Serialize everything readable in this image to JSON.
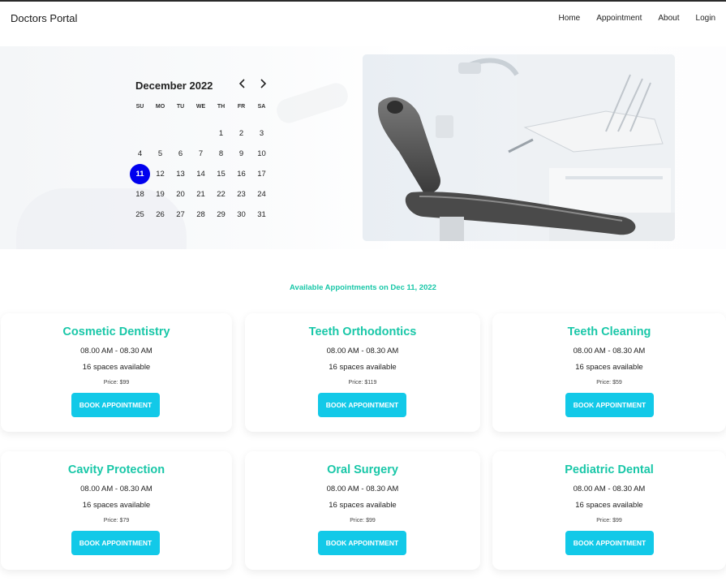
{
  "navbar": {
    "brand": "Doctors Portal",
    "links": [
      "Home",
      "Appointment",
      "About",
      "Login"
    ]
  },
  "calendar": {
    "month_label": "December 2022",
    "weekdays": [
      "SU",
      "MO",
      "TU",
      "WE",
      "TH",
      "FR",
      "SA"
    ],
    "weeks": [
      [
        "",
        "",
        "",
        "",
        "1",
        "2",
        "3"
      ],
      [
        "4",
        "5",
        "6",
        "7",
        "8",
        "9",
        "10"
      ],
      [
        "11",
        "12",
        "13",
        "14",
        "15",
        "16",
        "17"
      ],
      [
        "18",
        "19",
        "20",
        "21",
        "22",
        "23",
        "24"
      ],
      [
        "25",
        "26",
        "27",
        "28",
        "29",
        "30",
        "31"
      ]
    ],
    "selected_day": "11",
    "prev_icon": "chevron-left-icon",
    "next_icon": "chevron-right-icon"
  },
  "hero": {
    "image": "dental-chair-photo"
  },
  "appointments": {
    "title": "Available Appointments on Dec 11, 2022",
    "services": [
      {
        "name": "Cosmetic Dentistry",
        "time": "08.00 AM - 08.30 AM",
        "spaces": "16 spaces available",
        "price": "Price: $99",
        "button": "BOOK APPOINTMENT"
      },
      {
        "name": "Teeth Orthodontics",
        "time": "08.00 AM - 08.30 AM",
        "spaces": "16 spaces available",
        "price": "Price: $119",
        "button": "BOOK APPOINTMENT"
      },
      {
        "name": "Teeth Cleaning",
        "time": "08.00 AM - 08.30 AM",
        "spaces": "16 spaces available",
        "price": "Price: $59",
        "button": "BOOK APPOINTMENT"
      },
      {
        "name": "Cavity Protection",
        "time": "08.00 AM - 08.30 AM",
        "spaces": "16 spaces available",
        "price": "Price: $79",
        "button": "BOOK APPOINTMENT"
      },
      {
        "name": "Oral Surgery",
        "time": "08.00 AM - 08.30 AM",
        "spaces": "16 spaces available",
        "price": "Price: $99",
        "button": "BOOK APPOINTMENT"
      },
      {
        "name": "Pediatric Dental",
        "time": "08.00 AM - 08.30 AM",
        "spaces": "16 spaces available",
        "price": "Price: $99",
        "button": "BOOK APPOINTMENT"
      }
    ]
  },
  "colors": {
    "accent": "#19c7a8",
    "button": "#12c9e8",
    "selected_day": "#0000ee"
  }
}
